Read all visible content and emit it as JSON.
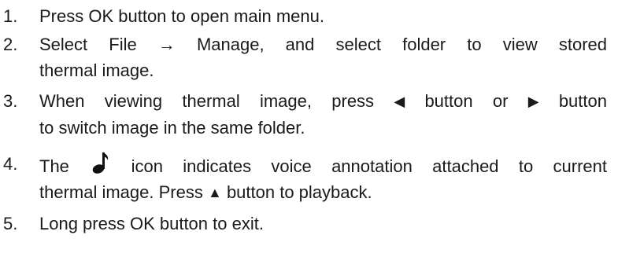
{
  "steps": [
    {
      "number": "1.",
      "lines": [
        "Press OK button to open main menu."
      ]
    },
    {
      "number": "2.",
      "lines": [
        "Select File → Manage, and select folder to view stored",
        "thermal image."
      ]
    },
    {
      "number": "3.",
      "line1": {
        "a": "When viewing thermal image, press",
        "b": "button or",
        "c": "button"
      },
      "line2": "to switch image in the same folder."
    },
    {
      "number": "4.",
      "line1": {
        "a": "The",
        "b": "icon indicates voice annotation attached to current"
      },
      "line2": {
        "a": "thermal image. Press",
        "b": "button to playback."
      }
    },
    {
      "number": "5.",
      "lines": [
        "Long press OK button to exit."
      ]
    }
  ],
  "icons": {
    "left": "◀",
    "right": "▶",
    "up": "▲",
    "voice_note": "music-note-icon"
  }
}
